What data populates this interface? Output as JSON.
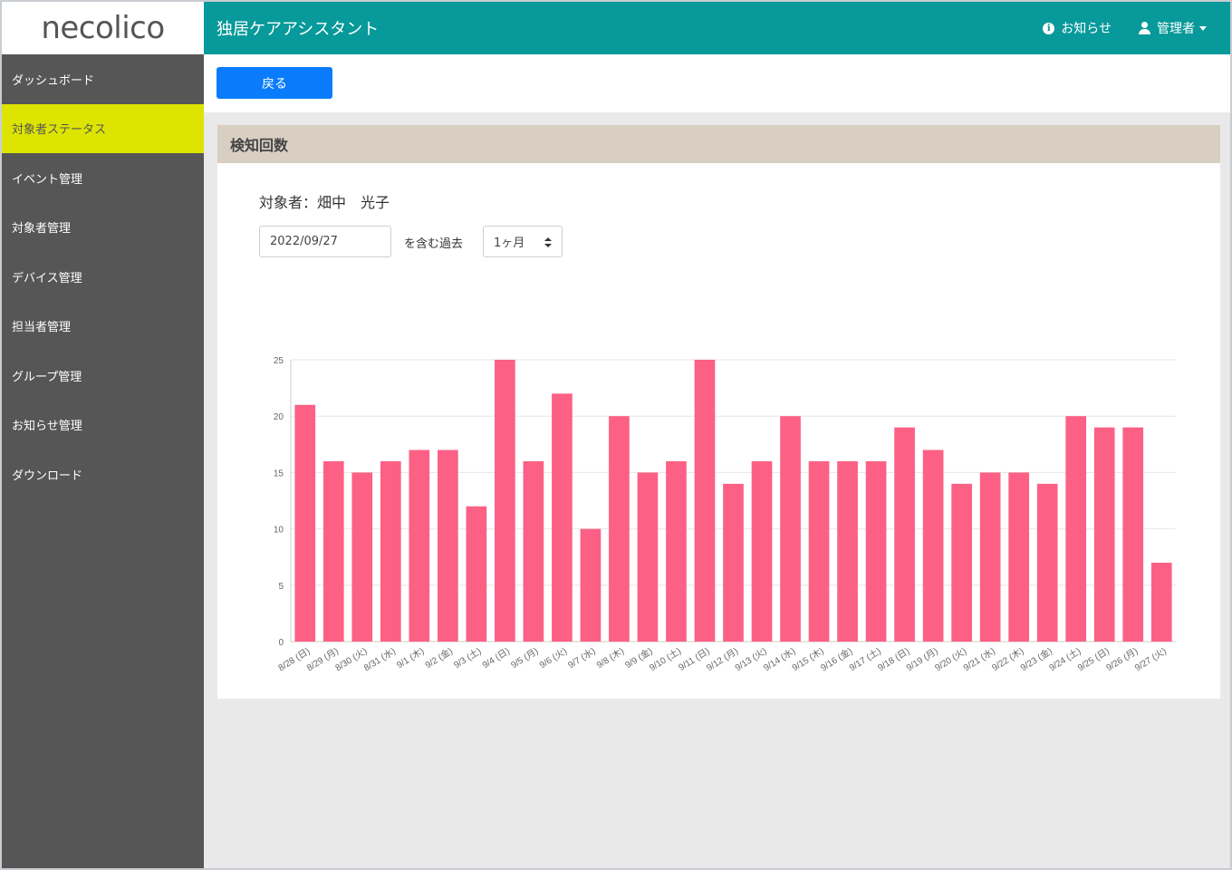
{
  "logo": {
    "text": "necolico"
  },
  "header": {
    "title": "独居ケアアシスタント",
    "notices_label": "お知らせ",
    "user_label": "管理者"
  },
  "sidebar": {
    "items": [
      {
        "label": "ダッシュボード"
      },
      {
        "label": "対象者ステータス",
        "active": true
      },
      {
        "label": "イベント管理"
      },
      {
        "label": "対象者管理"
      },
      {
        "label": "デバイス管理"
      },
      {
        "label": "担当者管理"
      },
      {
        "label": "グループ管理"
      },
      {
        "label": "お知らせ管理"
      },
      {
        "label": "ダウンロード"
      }
    ]
  },
  "toolbar": {
    "back_label": "戻る"
  },
  "panel": {
    "title": "検知回数",
    "subject": "対象者：畑中　光子",
    "date_value": "2022/09/27",
    "including_label": "を含む過去",
    "period_value": "1ヶ月"
  },
  "colors": {
    "accent": "#08999a",
    "active_nav": "#dde400",
    "bar": "#fc6185",
    "button": "#0a7cfb"
  },
  "chart_data": {
    "type": "bar",
    "categories": [
      "8/28 (日)",
      "8/29 (月)",
      "8/30 (火)",
      "8/31 (水)",
      "9/1 (木)",
      "9/2 (金)",
      "9/3 (土)",
      "9/4 (日)",
      "9/5 (月)",
      "9/6 (火)",
      "9/7 (水)",
      "9/8 (木)",
      "9/9 (金)",
      "9/10 (土)",
      "9/11 (日)",
      "9/12 (月)",
      "9/13 (火)",
      "9/14 (水)",
      "9/15 (木)",
      "9/16 (金)",
      "9/17 (土)",
      "9/18 (日)",
      "9/19 (月)",
      "9/20 (火)",
      "9/21 (水)",
      "9/22 (木)",
      "9/23 (金)",
      "9/24 (土)",
      "9/25 (日)",
      "9/26 (月)",
      "9/27 (火)"
    ],
    "values": [
      21,
      16,
      15,
      16,
      17,
      17,
      12,
      25,
      16,
      22,
      10,
      20,
      15,
      16,
      25,
      14,
      16,
      20,
      16,
      16,
      16,
      19,
      17,
      14,
      15,
      15,
      14,
      20,
      19,
      19,
      7
    ],
    "yticks": [
      "0",
      "5",
      "10",
      "15",
      "20",
      "25"
    ],
    "ylim": [
      0,
      25
    ],
    "grid": true
  }
}
